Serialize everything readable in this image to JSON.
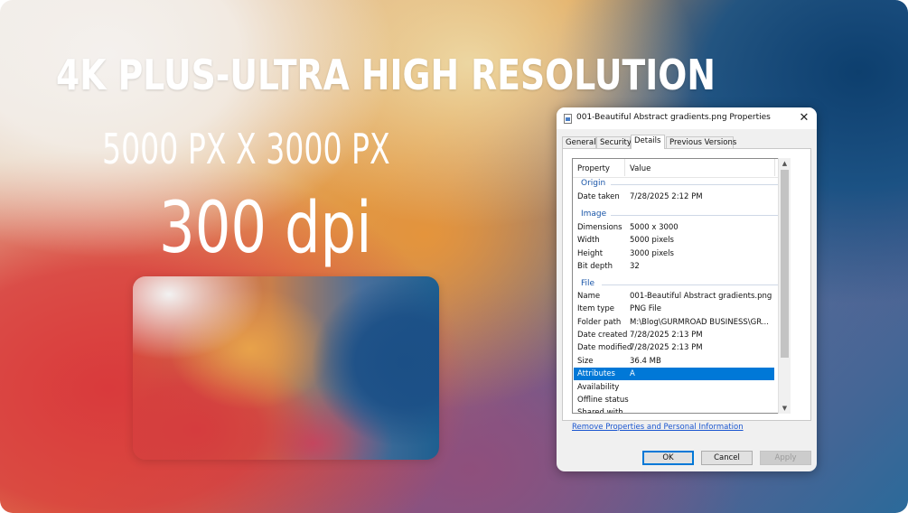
{
  "banner": {
    "headline": "4K PLUS-ULTRA HIGH RESOLUTION",
    "dimensions": "5000 PX X 3000 PX",
    "dpi": "300 dpi"
  },
  "dialog": {
    "title": "001-Beautiful Abstract gradients.png Properties",
    "close_label": "✕",
    "tabs": [
      {
        "label": "General",
        "active": false
      },
      {
        "label": "Security",
        "active": false
      },
      {
        "label": "Details",
        "active": true
      },
      {
        "label": "Previous Versions",
        "active": false
      }
    ],
    "columns": {
      "property": "Property",
      "value": "Value"
    },
    "groups": {
      "origin": "Origin",
      "image": "Image",
      "file": "File"
    },
    "origin_rows": [
      {
        "key": "Date taken",
        "value": "7/28/2025 2:12 PM"
      }
    ],
    "image_rows": [
      {
        "key": "Dimensions",
        "value": "5000 x 3000"
      },
      {
        "key": "Width",
        "value": "5000 pixels"
      },
      {
        "key": "Height",
        "value": "3000 pixels"
      },
      {
        "key": "Bit depth",
        "value": "32"
      }
    ],
    "file_rows": [
      {
        "key": "Name",
        "value": "001-Beautiful Abstract gradients.png"
      },
      {
        "key": "Item type",
        "value": "PNG File"
      },
      {
        "key": "Folder path",
        "value": "M:\\Blog\\GURMROAD BUSINESS\\GR..."
      },
      {
        "key": "Date created",
        "value": "7/28/2025 2:13 PM"
      },
      {
        "key": "Date modified",
        "value": "7/28/2025 2:13 PM"
      },
      {
        "key": "Size",
        "value": "36.4 MB"
      },
      {
        "key": "Attributes",
        "value": "A",
        "selected": true
      },
      {
        "key": "Availability",
        "value": ""
      },
      {
        "key": "Offline status",
        "value": ""
      },
      {
        "key": "Shared with",
        "value": ""
      }
    ],
    "link_text": "Remove Properties and Personal Information",
    "buttons": {
      "ok": "OK",
      "cancel": "Cancel",
      "apply": "Apply"
    },
    "selection_color": "#0078d7",
    "link_color": "#1a56d0"
  }
}
